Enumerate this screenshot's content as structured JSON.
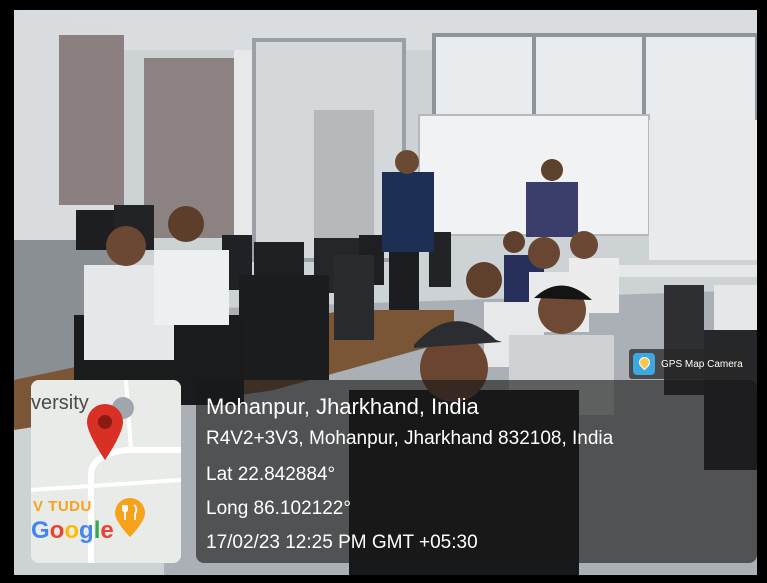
{
  "badge": {
    "text": "GPS Map Camera",
    "icon": "gps-map-camera-icon"
  },
  "map": {
    "label_top": "versity",
    "label_bottom": "V TUDU",
    "logo": "Google",
    "colors": {
      "pin": "#d93025",
      "food_pin": "#f6a21b"
    }
  },
  "info": {
    "place_title": "Mohanpur, Jharkhand, India",
    "address": "R4V2+3V3, Mohanpur, Jharkhand 832108, India",
    "latitude": "Lat 22.842884°",
    "longitude": "Long 86.102122°",
    "datetime": "17/02/23 12:25 PM GMT +05:30"
  }
}
